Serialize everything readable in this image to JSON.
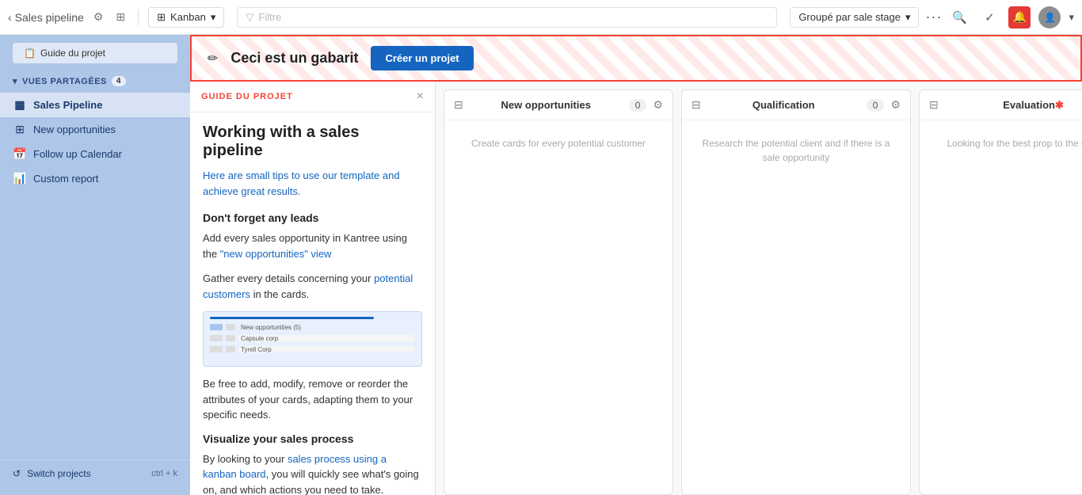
{
  "topnav": {
    "back_label": "Sales pipeline",
    "settings_icon": "⚙",
    "menu_icon": "≡",
    "kanban_label": "Kanban",
    "filter_placeholder": "Filtre",
    "groupby_label": "Groupé par sale stage",
    "more_icon": "···",
    "search_icon": "🔍",
    "check_icon": "✓",
    "bell_icon": "🔔",
    "avatar_label": "U"
  },
  "sidebar": {
    "guide_btn": "Guide du projet",
    "section_header": "VUES PARTAGÉES",
    "section_count": "4",
    "items": [
      {
        "id": "sales-pipeline",
        "icon": "▦",
        "label": "Sales Pipeline",
        "active": true
      },
      {
        "id": "new-opportunities",
        "icon": "⊞",
        "label": "New opportunities",
        "active": false
      },
      {
        "id": "follow-up-calendar",
        "icon": "📅",
        "label": "Follow up Calendar",
        "active": false
      },
      {
        "id": "custom-report",
        "icon": "📊",
        "label": "Custom report",
        "active": false
      }
    ],
    "footer_label": "Switch projects",
    "footer_shortcut": "ctrl + k"
  },
  "template_banner": {
    "edit_icon": "✏",
    "title": "Ceci est un gabarit",
    "create_btn": "Créer un projet"
  },
  "guide_panel": {
    "header_label": "GUIDE DU PROJET",
    "close_icon": "×",
    "main_title": "Working with a sales pipeline",
    "intro": "Here are small tips to use our template and achieve great results.",
    "sections": [
      {
        "title": "Don't forget any leads",
        "paragraphs": [
          "Add every sales opportunity in Kantree using the \"new opportunities\" view",
          "Gather every details concerning your potential customers in the cards."
        ]
      },
      {
        "title": "Visualize your sales process",
        "paragraphs": [
          "By looking to your sales process using a kanban board, you will quickly see what's going on, and which actions you need to take."
        ]
      }
    ],
    "be_free_text": "Be free to add, modify, remove or reorder the attributes of your cards, adapting them to your specific needs."
  },
  "kanban": {
    "columns": [
      {
        "id": "new-opportunities",
        "title": "New opportunities",
        "count": "0",
        "hint": "Create cards for every potential customer",
        "star": false
      },
      {
        "id": "qualification",
        "title": "Qualification",
        "count": "0",
        "hint": "Research the potential client and if there is a sale opportunity",
        "star": false
      },
      {
        "id": "evaluation",
        "title": "Evaluation",
        "count": "",
        "hint": "Looking for the best prop to the customer",
        "star": true
      }
    ]
  }
}
